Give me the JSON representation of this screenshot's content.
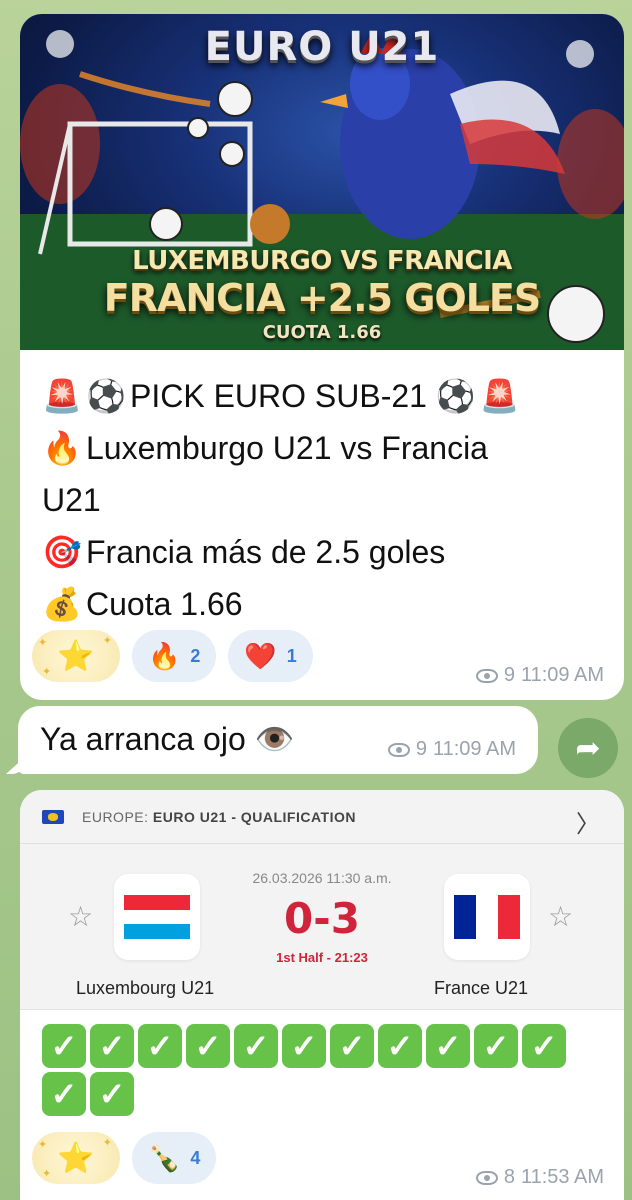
{
  "post1": {
    "banner": {
      "title": "EURO U21",
      "match": "LUXEMBURGO VS FRANCIA",
      "pick": "FRANCIA +2.5 GOLES",
      "odds": "CUOTA 1.66"
    },
    "lines": [
      {
        "icons": [
          "🚨",
          "⚽"
        ],
        "text": "PICK EURO SUB-21",
        "trail": [
          "⚽",
          "🚨"
        ]
      },
      {
        "icons": [
          "🔥"
        ],
        "text": "Luxemburgo U21 vs Francia"
      },
      {
        "icons": [],
        "text": "U21"
      },
      {
        "icons": [
          "🎯"
        ],
        "text": "Francia más de 2.5 goles"
      },
      {
        "icons": [
          "💰"
        ],
        "text": "Cuota 1.66"
      }
    ],
    "reactions": [
      {
        "emoji": "⭐",
        "count": ""
      },
      {
        "emoji": "🔥",
        "count": "2"
      },
      {
        "emoji": "❤️",
        "count": "1"
      }
    ],
    "views": "9",
    "time": "11:09 AM"
  },
  "post2": {
    "text": "Ya arranca ojo 👁️",
    "views": "9",
    "time": "11:09 AM"
  },
  "post3": {
    "competition_prefix": "EUROPE:",
    "competition": "EURO U21 - QUALIFICATION",
    "date": "26.03.2026 11:30 a.m.",
    "score": "0-3",
    "status": "1st Half - 21:23",
    "home_team": "Luxembourg U21",
    "away_team": "France U21",
    "check_count": 13,
    "reactions": [
      {
        "emoji": "⭐",
        "count": ""
      },
      {
        "emoji": "🍾",
        "count": "4"
      }
    ],
    "views": "8",
    "time": "11:53 AM"
  },
  "colors": {
    "background": "#a9c98e",
    "score_red": "#d0243b",
    "reaction_blue": "#3a7bd5",
    "check_green": "#67c24a"
  }
}
